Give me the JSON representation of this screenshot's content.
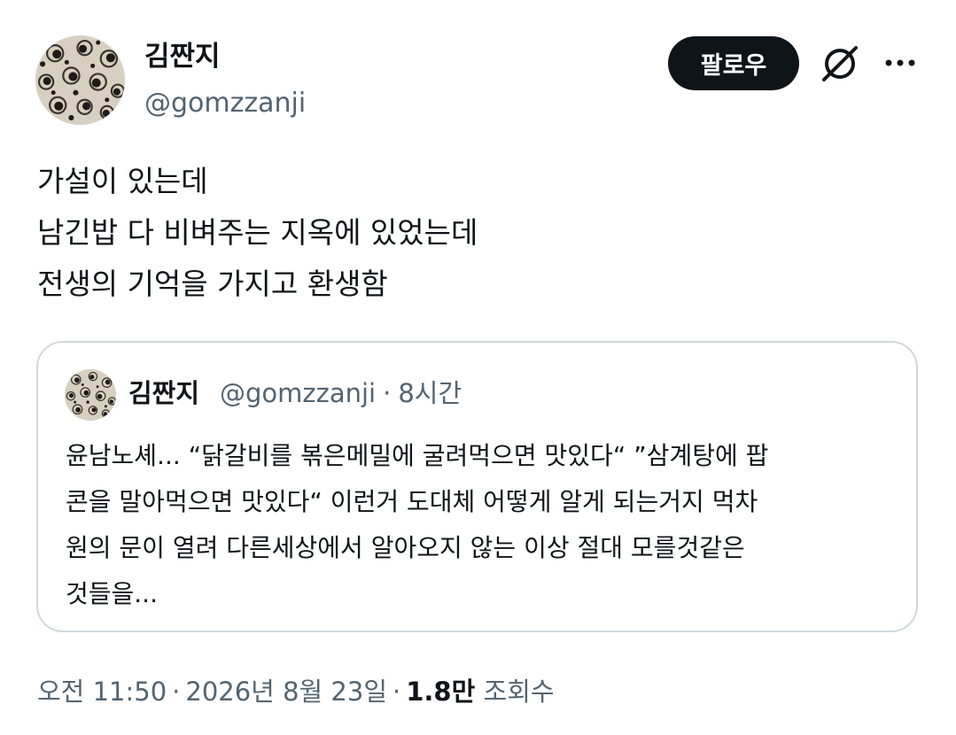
{
  "author": {
    "display_name": "김짠지",
    "handle": "@gomzzanji"
  },
  "actions": {
    "follow_label": "팔로우",
    "grok_icon": "slashed-circle-icon",
    "more_icon": "more-dots-icon"
  },
  "tweet": {
    "lines": [
      "가설이 있는데",
      "남긴밥 다 비벼주는 지옥에 있었는데",
      "전생의 기억을 가지고 환생함"
    ]
  },
  "quote": {
    "display_name": "김짠지",
    "handle": "@gomzzanji",
    "separator": "·",
    "time": "8시간",
    "lines": [
      "윤남노셰... “닭갈비를 볶은메밀에 굴려먹으면 맛있다“ ”삼계탕에 팝",
      "콘을 말아먹으면 맛있다“ 이런거 도대체 어떻게 알게 되는거지 먹차",
      "원의 문이 열려 다른세상에서 알아오지 않는 이상 절대 모를것같은",
      "것들을..."
    ]
  },
  "footer": {
    "time": "오전 11:50",
    "separator": "·",
    "date": "2026년 8월 23일",
    "views_count": "1.8만",
    "views_label": "조회수"
  },
  "colors": {
    "text": "#0f1419",
    "secondary": "#536471",
    "border": "#cfd9de",
    "button_bg": "#0f1419"
  }
}
